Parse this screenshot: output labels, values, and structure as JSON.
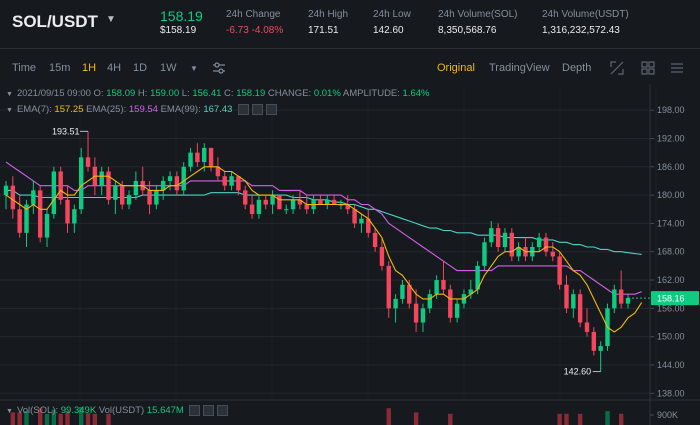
{
  "ticker": {
    "pair": "SOL/USDT",
    "last_price": "158.19",
    "last_price_usd": "$158.19",
    "stats": [
      {
        "label": "24h Change",
        "value": "-6.73 -4.08%",
        "negative": true
      },
      {
        "label": "24h High",
        "value": "171.51"
      },
      {
        "label": "24h Low",
        "value": "142.60"
      },
      {
        "label": "24h Volume(SOL)",
        "value": "8,350,568.76"
      },
      {
        "label": "24h Volume(USDT)",
        "value": "1,316,232,572.43"
      }
    ]
  },
  "toolbar": {
    "time_label": "Time",
    "intervals": [
      "15m",
      "1H",
      "4H",
      "1D",
      "1W"
    ],
    "active_interval": "1H",
    "views": [
      "Original",
      "TradingView",
      "Depth"
    ],
    "active_view": "Original",
    "icons": [
      "chevron-down-icon",
      "settings-sliders-icon",
      "expand-icon",
      "grid-icon",
      "menu-icon"
    ]
  },
  "info": {
    "datetime": "2021/09/15 09:00",
    "open_label": "O:",
    "open": "158.09",
    "high_label": "H:",
    "high": "159.00",
    "low_label": "L:",
    "low": "156.41",
    "close_label": "C:",
    "close": "158.19",
    "change_label": "CHANGE:",
    "change": "0.01%",
    "amplitude_label": "AMPLITUDE:",
    "amplitude": "1.64%"
  },
  "ema": {
    "ema7_label": "EMA(7):",
    "ema7": "157.25",
    "ema25_label": "EMA(25):",
    "ema25": "159.54",
    "ema99_label": "EMA(99):",
    "ema99": "167.43"
  },
  "volume": {
    "vol_sol_label": "Vol(SOL):",
    "vol_sol": "99.349K",
    "vol_usdt_label": "Vol(USDT)",
    "vol_usdt": "15.647M",
    "axis_label": "900K"
  },
  "colors": {
    "up": "#0ecb81",
    "down": "#f6465d",
    "ema7": "#f0b90b",
    "ema25": "#d660e8",
    "ema99": "#4fd1c5",
    "accent": "#f0b90b"
  },
  "chart_data": {
    "type": "candlestick",
    "y_axis": {
      "ticks": [
        138,
        144,
        150,
        156,
        162,
        168,
        174,
        180,
        186,
        192,
        198
      ],
      "tick_labels": [
        "138.00",
        "144.00",
        "150.00",
        "156.00",
        "162.00",
        "168.00",
        "174.00",
        "180.00",
        "186.00",
        "192.00",
        "198.00"
      ],
      "ylim": [
        137,
        201
      ]
    },
    "current_price_label": "158.16",
    "current_price": 158.16,
    "annotations": [
      {
        "text": "193.51",
        "value": 193.51
      },
      {
        "text": "142.60",
        "value": 142.6
      }
    ],
    "candles": [
      {
        "o": 180,
        "h": 183,
        "l": 177,
        "c": 182
      },
      {
        "o": 182,
        "h": 184,
        "l": 175,
        "c": 177
      },
      {
        "o": 177,
        "h": 180,
        "l": 171,
        "c": 172
      },
      {
        "o": 172,
        "h": 179,
        "l": 169,
        "c": 178
      },
      {
        "o": 178,
        "h": 183,
        "l": 176,
        "c": 181
      },
      {
        "o": 181,
        "h": 182,
        "l": 170,
        "c": 171
      },
      {
        "o": 171,
        "h": 177,
        "l": 169,
        "c": 176
      },
      {
        "o": 176,
        "h": 186,
        "l": 175,
        "c": 185
      },
      {
        "o": 185,
        "h": 186,
        "l": 178,
        "c": 179
      },
      {
        "o": 179,
        "h": 182,
        "l": 172,
        "c": 174
      },
      {
        "o": 174,
        "h": 178,
        "l": 172,
        "c": 177
      },
      {
        "o": 177,
        "h": 190,
        "l": 176,
        "c": 188
      },
      {
        "o": 188,
        "h": 193.51,
        "l": 185,
        "c": 186
      },
      {
        "o": 186,
        "h": 188,
        "l": 180,
        "c": 182
      },
      {
        "o": 182,
        "h": 186,
        "l": 180,
        "c": 185
      },
      {
        "o": 185,
        "h": 186,
        "l": 178,
        "c": 179
      },
      {
        "o": 179,
        "h": 183,
        "l": 176,
        "c": 182
      },
      {
        "o": 182,
        "h": 183,
        "l": 177,
        "c": 178
      },
      {
        "o": 178,
        "h": 181,
        "l": 177,
        "c": 180
      },
      {
        "o": 180,
        "h": 185,
        "l": 179,
        "c": 183
      },
      {
        "o": 183,
        "h": 186,
        "l": 180,
        "c": 181
      },
      {
        "o": 181,
        "h": 183,
        "l": 176,
        "c": 178
      },
      {
        "o": 178,
        "h": 182,
        "l": 177,
        "c": 181
      },
      {
        "o": 181,
        "h": 184,
        "l": 179,
        "c": 183
      },
      {
        "o": 183,
        "h": 185,
        "l": 181,
        "c": 184
      },
      {
        "o": 184,
        "h": 185,
        "l": 180,
        "c": 181
      },
      {
        "o": 181,
        "h": 187,
        "l": 180,
        "c": 186
      },
      {
        "o": 186,
        "h": 190,
        "l": 185,
        "c": 189
      },
      {
        "o": 189,
        "h": 191,
        "l": 186,
        "c": 187
      },
      {
        "o": 187,
        "h": 191,
        "l": 185,
        "c": 190
      },
      {
        "o": 190,
        "h": 190,
        "l": 185,
        "c": 186
      },
      {
        "o": 186,
        "h": 188,
        "l": 183,
        "c": 184
      },
      {
        "o": 184,
        "h": 185,
        "l": 181,
        "c": 182
      },
      {
        "o": 182,
        "h": 185,
        "l": 181,
        "c": 184
      },
      {
        "o": 184,
        "h": 184,
        "l": 180,
        "c": 181
      },
      {
        "o": 181,
        "h": 182,
        "l": 177,
        "c": 178
      },
      {
        "o": 178,
        "h": 180,
        "l": 175,
        "c": 176
      },
      {
        "o": 176,
        "h": 180,
        "l": 175,
        "c": 179
      },
      {
        "o": 179,
        "h": 180,
        "l": 177,
        "c": 178
      },
      {
        "o": 178,
        "h": 181,
        "l": 176,
        "c": 180
      },
      {
        "o": 180,
        "h": 180,
        "l": 177,
        "c": 177
      },
      {
        "o": 177,
        "h": 178,
        "l": 176,
        "c": 177
      },
      {
        "o": 177,
        "h": 180,
        "l": 176,
        "c": 179
      },
      {
        "o": 179,
        "h": 181,
        "l": 177,
        "c": 178
      },
      {
        "o": 178,
        "h": 180,
        "l": 176,
        "c": 177
      },
      {
        "o": 177,
        "h": 180,
        "l": 176,
        "c": 179
      },
      {
        "o": 179,
        "h": 180,
        "l": 178,
        "c": 178
      },
      {
        "o": 178,
        "h": 180,
        "l": 177,
        "c": 179
      },
      {
        "o": 179,
        "h": 180,
        "l": 178,
        "c": 178
      },
      {
        "o": 178,
        "h": 179,
        "l": 177,
        "c": 178
      },
      {
        "o": 178,
        "h": 180,
        "l": 176,
        "c": 177
      },
      {
        "o": 177,
        "h": 178,
        "l": 173,
        "c": 174
      },
      {
        "o": 174,
        "h": 176,
        "l": 172,
        "c": 175
      },
      {
        "o": 175,
        "h": 177,
        "l": 171,
        "c": 172
      },
      {
        "o": 172,
        "h": 173,
        "l": 168,
        "c": 169
      },
      {
        "o": 169,
        "h": 171,
        "l": 164,
        "c": 165
      },
      {
        "o": 165,
        "h": 166,
        "l": 154,
        "c": 156
      },
      {
        "o": 156,
        "h": 159,
        "l": 153,
        "c": 158
      },
      {
        "o": 158,
        "h": 162,
        "l": 157,
        "c": 161
      },
      {
        "o": 161,
        "h": 162,
        "l": 156,
        "c": 157
      },
      {
        "o": 157,
        "h": 160,
        "l": 151,
        "c": 153
      },
      {
        "o": 153,
        "h": 157,
        "l": 151,
        "c": 156
      },
      {
        "o": 156,
        "h": 160,
        "l": 155,
        "c": 159
      },
      {
        "o": 159,
        "h": 163,
        "l": 158,
        "c": 162
      },
      {
        "o": 162,
        "h": 166,
        "l": 159,
        "c": 160
      },
      {
        "o": 160,
        "h": 161,
        "l": 153,
        "c": 154
      },
      {
        "o": 154,
        "h": 158,
        "l": 153,
        "c": 157
      },
      {
        "o": 157,
        "h": 160,
        "l": 156,
        "c": 159
      },
      {
        "o": 159,
        "h": 162,
        "l": 158,
        "c": 160
      },
      {
        "o": 160,
        "h": 166,
        "l": 159,
        "c": 165
      },
      {
        "o": 165,
        "h": 171,
        "l": 164,
        "c": 170
      },
      {
        "o": 170,
        "h": 174.5,
        "l": 169,
        "c": 173
      },
      {
        "o": 173,
        "h": 174,
        "l": 168,
        "c": 169
      },
      {
        "o": 169,
        "h": 173,
        "l": 168,
        "c": 172
      },
      {
        "o": 172,
        "h": 173,
        "l": 166,
        "c": 167
      },
      {
        "o": 167,
        "h": 170,
        "l": 166,
        "c": 169
      },
      {
        "o": 169,
        "h": 171,
        "l": 166,
        "c": 167
      },
      {
        "o": 167,
        "h": 170,
        "l": 166,
        "c": 169
      },
      {
        "o": 169,
        "h": 172,
        "l": 168,
        "c": 171
      },
      {
        "o": 171,
        "h": 172,
        "l": 167,
        "c": 168
      },
      {
        "o": 168,
        "h": 170,
        "l": 166,
        "c": 167
      },
      {
        "o": 167,
        "h": 168,
        "l": 160,
        "c": 161
      },
      {
        "o": 161,
        "h": 163,
        "l": 155,
        "c": 156
      },
      {
        "o": 156,
        "h": 160,
        "l": 154,
        "c": 159
      },
      {
        "o": 159,
        "h": 160,
        "l": 152,
        "c": 153
      },
      {
        "o": 153,
        "h": 156,
        "l": 150,
        "c": 151
      },
      {
        "o": 151,
        "h": 152,
        "l": 146,
        "c": 147
      },
      {
        "o": 147,
        "h": 149,
        "l": 142.6,
        "c": 148
      },
      {
        "o": 148,
        "h": 157,
        "l": 147,
        "c": 156
      },
      {
        "o": 156,
        "h": 161,
        "l": 155,
        "c": 160
      },
      {
        "o": 160,
        "h": 164,
        "l": 156,
        "c": 157
      },
      {
        "o": 157,
        "h": 159,
        "l": 156,
        "c": 158.19
      }
    ],
    "ema7": [
      180,
      179,
      178,
      177,
      178,
      177,
      177,
      179,
      181,
      180,
      180,
      182,
      183,
      184,
      184,
      184,
      183,
      182,
      182,
      182,
      182,
      181,
      181,
      181,
      182,
      182,
      183,
      184,
      185,
      186,
      186,
      186,
      185,
      185,
      184,
      183,
      181,
      180,
      180,
      180,
      179,
      179,
      179,
      179,
      178,
      178,
      178,
      178,
      178,
      178,
      178,
      177,
      176,
      175,
      173,
      171,
      167,
      164,
      163,
      161,
      159,
      158,
      158,
      159,
      159,
      158,
      158,
      158,
      159,
      160,
      163,
      165,
      167,
      168,
      168,
      169,
      168,
      168,
      168,
      169,
      169,
      168,
      166,
      164,
      163,
      161,
      158,
      155,
      152,
      151,
      152,
      154,
      155,
      157.25
    ],
    "ema25": [
      187,
      186,
      185,
      184,
      183,
      182,
      182,
      182,
      182,
      182,
      181,
      181,
      182,
      182,
      182,
      182,
      182,
      182,
      182,
      182,
      182,
      182,
      182,
      182,
      182,
      182,
      182,
      183,
      183,
      183,
      183,
      183,
      183,
      183,
      183,
      183,
      182,
      182,
      182,
      182,
      181,
      181,
      181,
      181,
      180,
      180,
      180,
      180,
      180,
      180,
      179,
      179,
      178,
      178,
      177,
      176,
      174,
      173,
      172,
      171,
      170,
      169,
      168,
      167,
      166,
      165,
      164,
      164,
      164,
      164,
      164,
      164,
      165,
      165,
      165,
      165,
      165,
      165,
      165,
      165,
      165,
      165,
      165,
      164,
      164,
      163,
      162,
      161,
      160,
      159,
      159,
      159,
      159,
      159.54
    ],
    "ema99": [
      181,
      181,
      180,
      180,
      180,
      179.5,
      179.5,
      179.5,
      179.5,
      179.5,
      179.5,
      179.5,
      179.5,
      179.5,
      179.5,
      179.5,
      179.5,
      179.5,
      179.5,
      179.5,
      180,
      180,
      180,
      180,
      180,
      180,
      180,
      180,
      180,
      180,
      180.5,
      180.5,
      180.5,
      180.5,
      180.5,
      180,
      180,
      180,
      180,
      180,
      180,
      180,
      179.5,
      179.5,
      179.5,
      179,
      179,
      179,
      178.5,
      178.5,
      178,
      178,
      177.5,
      177,
      177,
      176.5,
      176,
      175.5,
      175,
      174.5,
      174,
      173.5,
      173,
      173,
      172.5,
      172.5,
      172,
      172,
      172,
      171.5,
      171.5,
      171.5,
      171.5,
      171,
      171,
      171,
      171,
      171,
      170.5,
      170.5,
      170.5,
      170,
      170,
      169.5,
      169.5,
      169,
      169,
      168.5,
      168.5,
      168,
      168,
      167.8,
      167.6,
      167.43
    ]
  }
}
